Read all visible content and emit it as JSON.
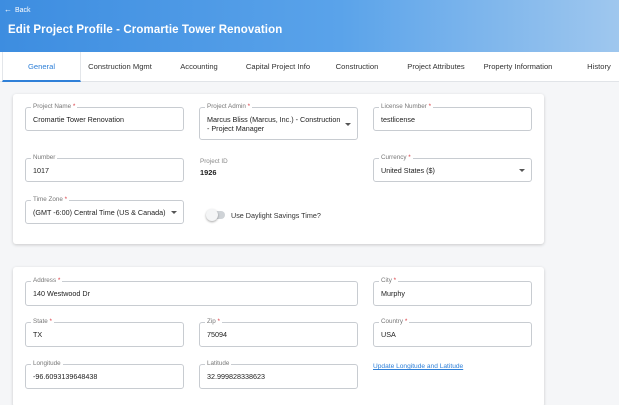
{
  "header": {
    "back_label": "Back",
    "title": "Edit Project Profile - Cromartie Tower Renovation"
  },
  "tabs": [
    {
      "label": "General",
      "active": true
    },
    {
      "label": "Construction Mgmt"
    },
    {
      "label": "Accounting"
    },
    {
      "label": "Capital Project Info"
    },
    {
      "label": "Construction"
    },
    {
      "label": "Project Attributes"
    },
    {
      "label": "Property Information"
    },
    {
      "label": "History"
    }
  ],
  "general": {
    "project_name": {
      "label": "Project Name",
      "value": "Cromartie Tower Renovation"
    },
    "project_admin": {
      "label": "Project Admin",
      "value": "Marcus Bliss (Marcus, Inc.) - Construction - Project Manager"
    },
    "license_number": {
      "label": "License Number",
      "value": "testlicense"
    },
    "number": {
      "label": "Number",
      "value": "1017"
    },
    "project_id": {
      "label": "Project ID",
      "value": "1926"
    },
    "currency": {
      "label": "Currency",
      "value": "United States ($)"
    },
    "time_zone": {
      "label": "Time Zone",
      "value": "(GMT -6:00) Central Time (US & Canada)"
    },
    "daylight_savings": {
      "label": "Use Daylight Savings Time?",
      "enabled": false
    }
  },
  "address": {
    "address": {
      "label": "Address",
      "value": "140 Westwood Dr"
    },
    "city": {
      "label": "City",
      "value": "Murphy"
    },
    "state": {
      "label": "State",
      "value": "TX"
    },
    "zip": {
      "label": "Zip",
      "value": "75094"
    },
    "country": {
      "label": "Country",
      "value": "USA"
    },
    "longitude": {
      "label": "Longitude",
      "value": "-96.6093139648438"
    },
    "latitude": {
      "label": "Latitude",
      "value": "32.999828338623"
    },
    "update_link": "Update Longitude and Latitude"
  },
  "required_marker": "*",
  "colors": {
    "accent": "#2f80d8",
    "required": "#d9363e",
    "header_start": "#3d8de0",
    "header_end": "#9fc7ee"
  }
}
